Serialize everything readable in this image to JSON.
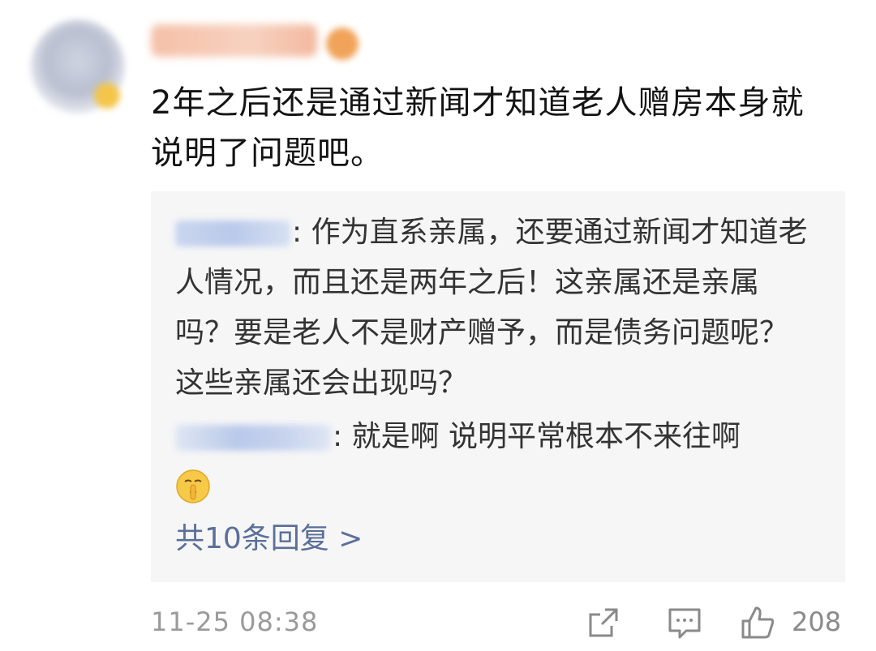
{
  "comment": {
    "text": "2年之后还是通过新闻才知道老人赠房本身就说明了问题吧。"
  },
  "replies": [
    {
      "text": ": 作为直系亲属，还要通过新闻才知道老人情况，而且还是两年之后！这亲属还是亲属吗？要是老人不是财产赠予，而是债务问题呢？这些亲属还会出现吗？"
    },
    {
      "text": ": 就是啊  说明平常根本不来往啊",
      "emoji": "shushing-face-emoji"
    }
  ],
  "more_replies_label": "共10条回复 >",
  "footer": {
    "timestamp": "11-25 08:38",
    "like_count": "208"
  },
  "colors": {
    "link": "#5b6f9a",
    "reply_bg": "#f6f6f7",
    "meta": "#9a9a9a"
  }
}
